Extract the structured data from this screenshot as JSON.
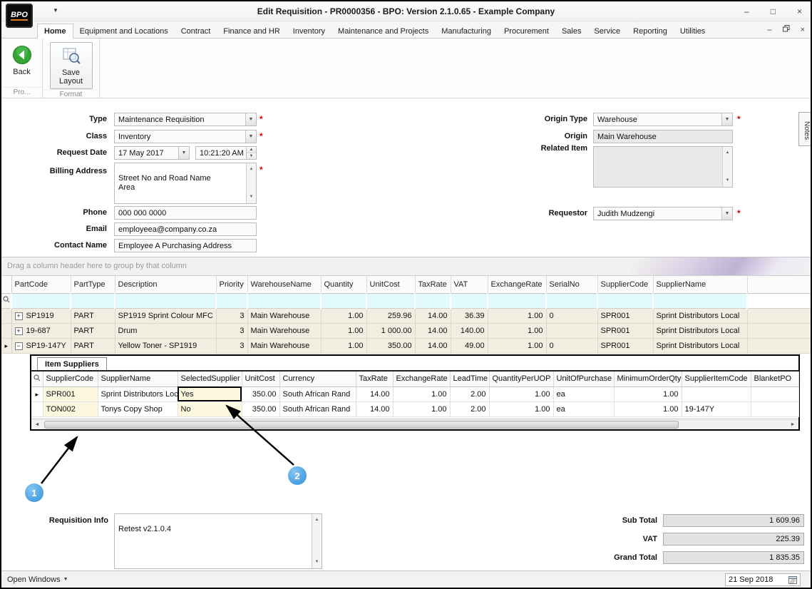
{
  "window": {
    "title": "Edit Requisition - PR0000356 - BPO: Version 2.1.0.65 - Example Company",
    "logo_text": "BPO"
  },
  "menu": {
    "tabs": [
      "Home",
      "Equipment and Locations",
      "Contract",
      "Finance and HR",
      "Inventory",
      "Maintenance and Projects",
      "Manufacturing",
      "Procurement",
      "Sales",
      "Service",
      "Reporting",
      "Utilities"
    ]
  },
  "ribbon": {
    "back_label": "Back",
    "save_layout_label": "Save Layout",
    "group1": "Pro...",
    "group2": "Format"
  },
  "form": {
    "required_marker": "*",
    "type_label": "Type",
    "type_value": "Maintenance Requisition",
    "class_label": "Class",
    "class_value": "Inventory",
    "request_date_label": "Request Date",
    "request_date_value": "17 May 2017",
    "request_time_value": "10:21:20 AM",
    "billing_address_label": "Billing Address",
    "billing_address_value": "Street No and Road Name\nArea",
    "phone_label": "Phone",
    "phone_value": "000 000 0000",
    "email_label": "Email",
    "email_value": "employeea@company.co.za",
    "contact_name_label": "Contact Name",
    "contact_name_value": "Employee A Purchasing Address",
    "origin_type_label": "Origin Type",
    "origin_type_value": "Warehouse",
    "origin_label": "Origin",
    "origin_value": "Main Warehouse",
    "related_item_label": "Related Item",
    "related_item_value": "",
    "requestor_label": "Requestor",
    "requestor_value": "Judith Mudzengi"
  },
  "notes_tab": "Notes",
  "grid": {
    "group_hint": "Drag a column header here to group by that column",
    "columns": [
      "PartCode",
      "PartType",
      "Description",
      "Priority",
      "WarehouseName",
      "Quantity",
      "UnitCost",
      "TaxRate",
      "VAT",
      "ExchangeRate",
      "SerialNo",
      "SupplierCode",
      "SupplierName"
    ],
    "rows": [
      [
        "SP1919",
        "PART",
        "SP1919 Sprint Colour MFC",
        "3",
        "Main Warehouse",
        "1.00",
        "259.96",
        "14.00",
        "36.39",
        "1.00",
        "0",
        "SPR001",
        "Sprint Distributors Local"
      ],
      [
        "19-687",
        "PART",
        "Drum",
        "3",
        "Main Warehouse",
        "1.00",
        "1 000.00",
        "14.00",
        "140.00",
        "1.00",
        "",
        "SPR001",
        "Sprint Distributors Local"
      ],
      [
        "SP19-147Y",
        "PART",
        "Yellow Toner - SP1919",
        "3",
        "Main Warehouse",
        "1.00",
        "350.00",
        "14.00",
        "49.00",
        "1.00",
        "0",
        "SPR001",
        "Sprint Distributors Local"
      ]
    ]
  },
  "subgrid": {
    "tab_label": "Item Suppliers",
    "columns": [
      "SupplierCode",
      "SupplierName",
      "SelectedSupplier",
      "UnitCost",
      "Currency",
      "TaxRate",
      "ExchangeRate",
      "LeadTime",
      "QuantityPerUOP",
      "UnitOfPurchase",
      "MinimumOrderQty",
      "SupplierItemCode",
      "BlanketPO"
    ],
    "rows": [
      [
        "SPR001",
        "Sprint Distributors Local",
        "Yes",
        "350.00",
        "South African Rand",
        "14.00",
        "1.00",
        "2.00",
        "1.00",
        "ea",
        "1.00",
        "",
        ""
      ],
      [
        "TON002",
        "Tonys Copy Shop",
        "No",
        "350.00",
        "South African Rand",
        "14.00",
        "1.00",
        "2.00",
        "1.00",
        "ea",
        "1.00",
        "19-147Y",
        ""
      ]
    ]
  },
  "callouts": {
    "one": "1",
    "two": "2"
  },
  "footer": {
    "requisition_info_label": "Requisition Info",
    "requisition_info_value": "Retest v2.1.0.4",
    "sub_total_label": "Sub Total",
    "sub_total_value": "1 609.96",
    "vat_label": "VAT",
    "vat_value": "225.39",
    "grand_total_label": "Grand Total",
    "grand_total_value": "1 835.35"
  },
  "statusbar": {
    "open_windows_label": "Open Windows",
    "date_value": "21 Sep 2018"
  },
  "colors": {
    "callout_blue": "#3f9ee8",
    "required_red": "#d40000",
    "row_beige": "#f1ede0",
    "filter_cyan": "#e3fafc",
    "edit_yellow": "#fbf8df",
    "back_green": "#35a635"
  }
}
